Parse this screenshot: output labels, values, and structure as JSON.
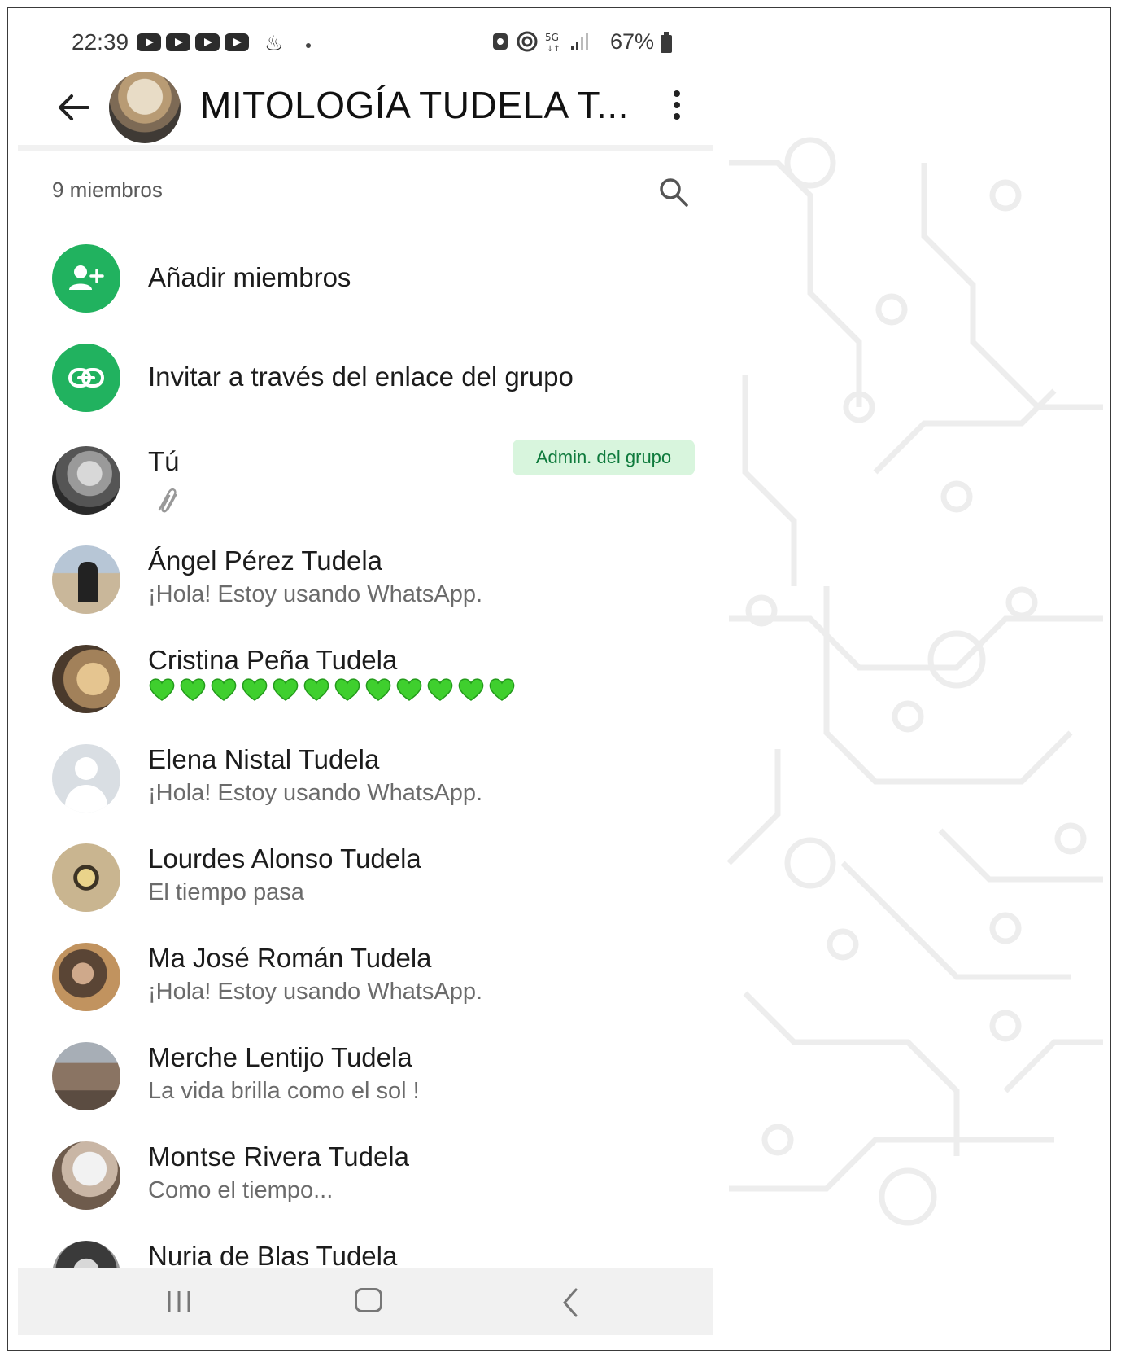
{
  "status_bar": {
    "time": "22:39",
    "network": "5G",
    "battery": "67%"
  },
  "header": {
    "title": "MITOLOGÍA TUDELA T..."
  },
  "members_header": {
    "count": "9 miembros"
  },
  "actions": [
    {
      "label": "Añadir miembros",
      "icon": "add-person-icon"
    },
    {
      "label": "Invitar a través del enlace del grupo",
      "icon": "link-icon"
    }
  ],
  "members": [
    {
      "name": "Tú",
      "badge": "Admin. del grupo",
      "about_icon": "paperclip-icon"
    },
    {
      "name": "Ángel Pérez Tudela",
      "about": "¡Hola! Estoy usando WhatsApp."
    },
    {
      "name": "Cristina Peña Tudela",
      "about": "💚💚💚💚💚💚💚💚💚💚💚💚",
      "heart_count": 12
    },
    {
      "name": "Elena Nistal Tudela",
      "about": "¡Hola! Estoy usando WhatsApp."
    },
    {
      "name": "Lourdes Alonso Tudela",
      "about": "El tiempo pasa"
    },
    {
      "name": "Ma José Román Tudela",
      "about": "¡Hola! Estoy usando WhatsApp."
    },
    {
      "name": "Merche Lentijo Tudela",
      "about": "La vida brilla como el sol !"
    },
    {
      "name": "Montse Rivera Tudela",
      "about": "Como el tiempo..."
    },
    {
      "name": "Nuria de Blas Tudela"
    }
  ],
  "colors": {
    "accent_green": "#21b25f",
    "badge_bg": "#d8f5dd",
    "badge_text": "#0e7a3c",
    "heart_green": "#3fcf2e"
  }
}
